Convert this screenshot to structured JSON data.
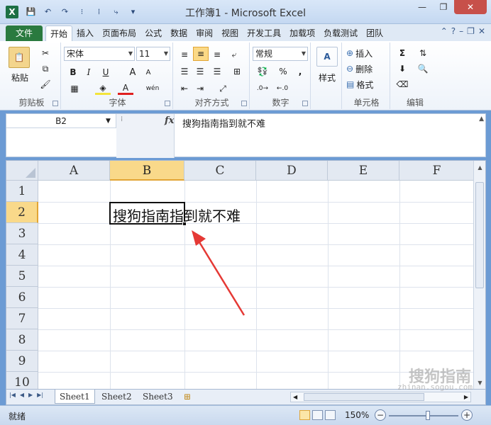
{
  "window": {
    "title": "工作簿1 - Microsoft Excel",
    "app_icon": "X"
  },
  "qat": {
    "save": "💾",
    "undo": "↶",
    "redo": "↷",
    "more1": "⁝",
    "more2": "⁞",
    "more3": "⤷",
    "customize": "▾"
  },
  "window_controls": {
    "minimize": "—",
    "restore": "❐",
    "close": "✕"
  },
  "tabs": [
    "文件",
    "开始",
    "插入",
    "页面布局",
    "公式",
    "数据",
    "审阅",
    "视图",
    "开发工具",
    "加载项",
    "负载测试",
    "团队"
  ],
  "active_tab_index": 1,
  "ribbon": {
    "clipboard": {
      "label": "剪贴板",
      "paste": "粘贴"
    },
    "font": {
      "label": "字体",
      "font_name": "宋体",
      "font_size": "11",
      "bold": "B",
      "italic": "I",
      "underline": "U",
      "grow": "A",
      "shrink": "A",
      "font_color": "A",
      "phonetic": "wén"
    },
    "alignment": {
      "label": "对齐方式"
    },
    "number": {
      "label": "数字",
      "format": "常规",
      "percent": "%",
      "comma": ","
    },
    "styles": {
      "label": "样式"
    },
    "cells": {
      "label": "单元格",
      "insert": "插入",
      "delete": "删除",
      "format": "格式"
    },
    "editing": {
      "label": "编辑",
      "sum": "Σ"
    }
  },
  "formula_bar": {
    "name_box": "B2",
    "fx": "fx",
    "content": "搜狗指南指到就不难"
  },
  "columns": [
    "A",
    "B",
    "C",
    "D",
    "E",
    "F"
  ],
  "active_column": "B",
  "rows": [
    "1",
    "2",
    "3",
    "4",
    "5",
    "6",
    "7",
    "8",
    "9",
    "10"
  ],
  "active_row": "2",
  "cell_b2": "搜狗指南指到就不难",
  "sheets": [
    "Sheet1",
    "Sheet2",
    "Sheet3"
  ],
  "active_sheet": "Sheet1",
  "status": {
    "text": "就绪",
    "zoom": "150%"
  },
  "watermark": {
    "text": "搜狗指南",
    "url": "zhinan.sogou.com"
  },
  "colors": {
    "file_tab": "#2a7a3f",
    "active_header": "#f9d98a",
    "arrow": "#e53935"
  }
}
